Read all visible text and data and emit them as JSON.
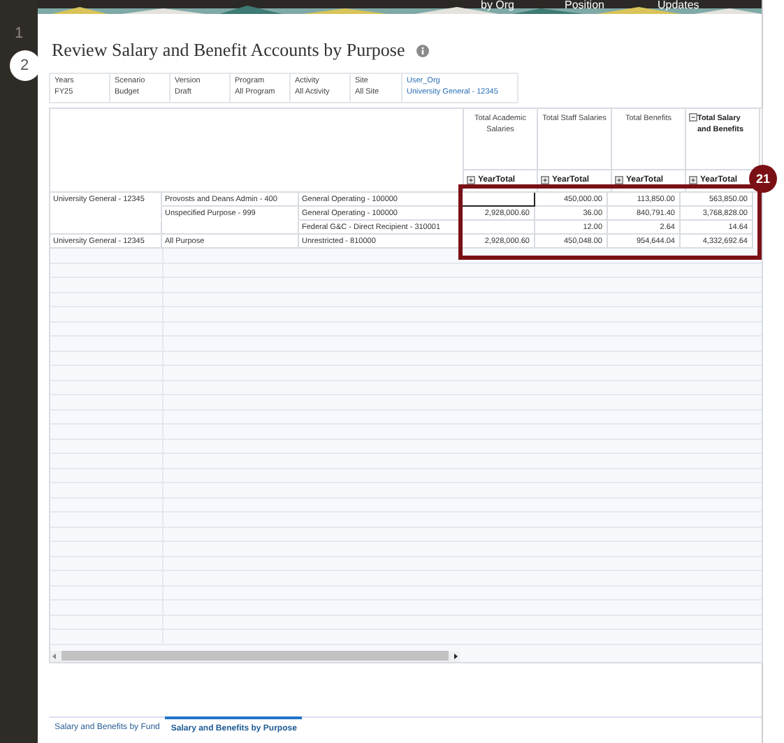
{
  "banner": {
    "links": [
      "by Org",
      "Position",
      "Updates"
    ]
  },
  "steps": [
    {
      "label": "1",
      "selected": false
    },
    {
      "label": "2",
      "selected": true
    }
  ],
  "title": "Review Salary and Benefit Accounts by Purpose",
  "pov": [
    {
      "label": "Years",
      "value": "FY25",
      "link": false
    },
    {
      "label": "Scenario",
      "value": "Budget",
      "link": false
    },
    {
      "label": "Version",
      "value": "Draft",
      "link": false
    },
    {
      "label": "Program",
      "value": "All Program",
      "link": false
    },
    {
      "label": "Activity",
      "value": "All Activity",
      "link": false
    },
    {
      "label": "Site",
      "value": "All Site",
      "link": false
    },
    {
      "label": "User_Org",
      "value": "University General - 12345",
      "link": true
    }
  ],
  "columns": [
    {
      "label": "Total Academic Salaries",
      "sub": "YearTotal",
      "expanded": false
    },
    {
      "label": "Total Staff Salaries",
      "sub": "YearTotal",
      "expanded": false
    },
    {
      "label": "Total Benefits",
      "sub": "YearTotal",
      "expanded": false
    },
    {
      "label": "Total Salary and Benefits",
      "sub": "YearTotal",
      "expanded": true
    }
  ],
  "rows": [
    {
      "entity": "University General - 12345",
      "purpose": "Provosts and Deans Admin - 400",
      "fund": "General Operating - 100000",
      "values": [
        {
          "selected": true
        },
        {
          "text": "450,000.00",
          "selected": false
        },
        {
          "text": "113,850.00",
          "selected": false
        },
        {
          "text": "563,850.00",
          "selected": false
        }
      ]
    },
    {
      "purpose": "Unspecified Purpose - 999",
      "fund": "General Operating - 100000",
      "values": [
        {
          "text": "2,928,000.60",
          "selected": false
        },
        {
          "text": "36.00",
          "selected": false
        },
        {
          "text": "840,791.40",
          "selected": false
        },
        {
          "text": "3,768,828.00",
          "selected": false
        }
      ]
    },
    {
      "fund": "Federal G&C - Direct Recipient - 310001",
      "values": [
        {
          "selected": false
        },
        {
          "text": "12.00",
          "selected": false
        },
        {
          "text": "2.64",
          "selected": false
        },
        {
          "text": "14.64",
          "selected": false
        }
      ]
    },
    {
      "entity": "University General - 12345",
      "purpose": "All Purpose",
      "fund": "Unrestricted - 810000",
      "values": [
        {
          "text": "2,928,000.60",
          "selected": false
        },
        {
          "text": "450,048.00",
          "selected": false
        },
        {
          "text": "954,644.04",
          "selected": false
        },
        {
          "text": "4,332,692.64",
          "selected": false
        }
      ]
    }
  ],
  "callout": {
    "label": "21"
  },
  "tabs": [
    {
      "label": "Salary and Benefits by Fund",
      "selected": false
    },
    {
      "label": "Salary and Benefits by Purpose",
      "selected": true
    }
  ]
}
